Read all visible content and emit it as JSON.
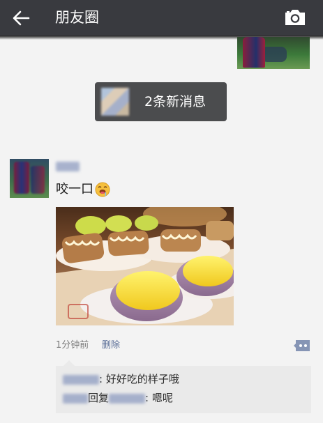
{
  "header": {
    "title": "朋友圈",
    "back_icon": "arrow-left-icon",
    "camera_icon": "camera-icon",
    "background": "#393a3f"
  },
  "notification": {
    "label": "2条新消息"
  },
  "post": {
    "text": "咬一口",
    "emoji": "drooling-face-emoji",
    "time": "1分钟前",
    "delete_label": "删除"
  },
  "comments": [
    {
      "separator": ": ",
      "text": "好好吃的样子哦"
    },
    {
      "reply_word": "回复",
      "separator": ": ",
      "text": "嗯呢"
    }
  ],
  "colors": {
    "link": "#576b95",
    "meta": "#7c7c7c",
    "comment_bg": "#eaeaea",
    "pill_bg": "#4b4c4e"
  }
}
